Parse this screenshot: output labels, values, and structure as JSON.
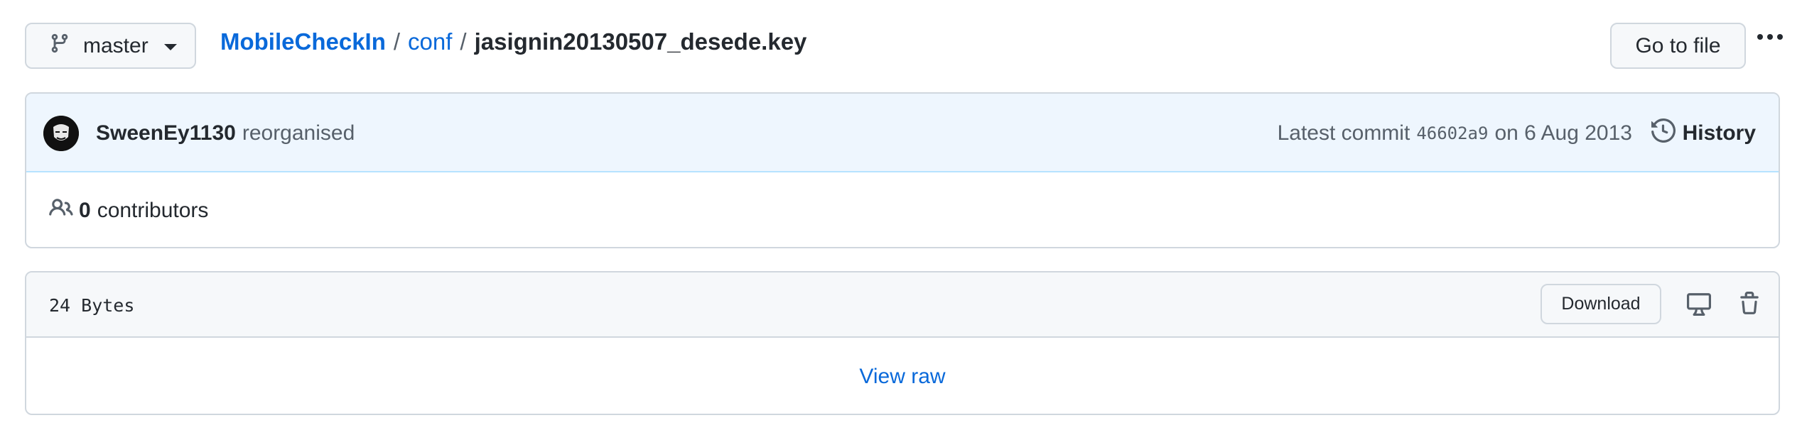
{
  "branch": {
    "name": "master",
    "icon": "git-branch-icon"
  },
  "breadcrumb": {
    "repo": "MobileCheckIn",
    "sep1": "/",
    "folder": "conf",
    "sep2": "/",
    "file": "jasignin20130507_desede.key"
  },
  "toolbar": {
    "goto_file_label": "Go to file",
    "more_icon": "kebab-horizontal-icon"
  },
  "commit": {
    "author": "SweenEy1130",
    "message": "reorganised",
    "latest_prefix": "Latest commit",
    "sha": "46602a9",
    "date_text": "on 6 Aug 2013",
    "history_label": "History",
    "history_icon": "history-icon"
  },
  "contributors": {
    "count": "0",
    "label": "contributors",
    "icon": "people-icon"
  },
  "file": {
    "size": "24 Bytes",
    "download_label": "Download",
    "desktop_icon": "desktop-icon",
    "trash_icon": "trash-icon",
    "view_raw_label": "View raw"
  },
  "colors": {
    "link": "#0969da",
    "commit_header_bg": "#eef6fe",
    "file_header_bg": "#f6f8fa",
    "border": "#d0d7de"
  }
}
